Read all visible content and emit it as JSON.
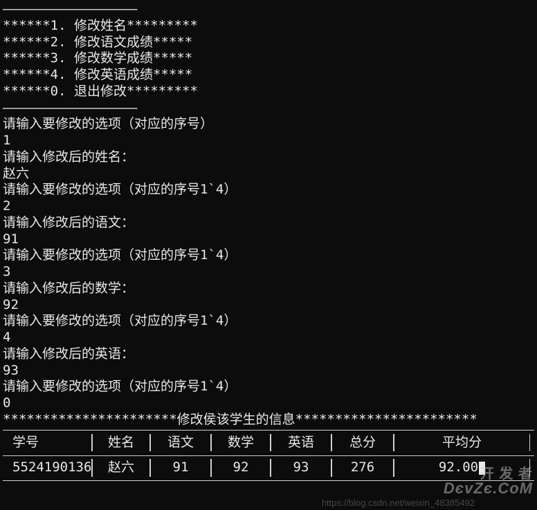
{
  "lines": {
    "dash1": "—————————————————",
    "menu1": "******1. 修改姓名*********",
    "menu2": "******2. 修改语文成绩*****",
    "menu3": "******3. 修改数学成绩*****",
    "menu4": "******4. 修改英语成绩*****",
    "menu0": "******0. 退出修改*********",
    "dash2": "—————————————————",
    "prompt1": "请输入要修改的选项（对应的序号）",
    "input1": "1",
    "prompt_name": "请输入修改后的姓名：",
    "input_name": "赵六",
    "prompt2": "请输入要修改的选项（对应的序号1`4）",
    "input2": "2",
    "prompt_chinese": "请输入修改后的语文：",
    "input_chinese": "91",
    "prompt3": "请输入要修改的选项（对应的序号1`4）",
    "input3": "3",
    "prompt_math": "请输入修改后的数学：",
    "input_math": "92",
    "prompt4": "请输入要修改的选项（对应的序号1`4）",
    "input4": "4",
    "prompt_english": "请输入修改后的英语：",
    "input_english": "93",
    "prompt5": "请输入要修改的选项（对应的序号1`4）",
    "input5": "0",
    "result_header": "**********************修改侯该学生的信息***********************"
  },
  "table": {
    "headers": {
      "id": "学号",
      "name": "姓名",
      "chinese": "语文",
      "math": "数学",
      "english": "英语",
      "total": "总分",
      "avg": "平均分"
    },
    "row": {
      "id": "5524190136",
      "name": "赵六",
      "chinese": "91",
      "math": "92",
      "english": "93",
      "total": "276",
      "avg": "92.00"
    }
  },
  "watermark": {
    "logo_cn": "开 发 者",
    "logo_en": "DєvZє.CoM",
    "url": "https://blog.csdn.net/weixin_48385492"
  }
}
